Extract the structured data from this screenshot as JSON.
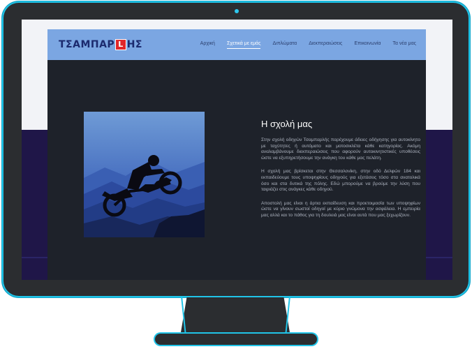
{
  "site": {
    "logo": {
      "text_before": "ΤΣΑΜΠΑΡ",
      "highlight": "L",
      "text_after": "ΗΣ"
    },
    "nav": [
      {
        "label": "Αρχική",
        "active": false
      },
      {
        "label": "Σχετικά με εμάς",
        "active": true
      },
      {
        "label": "Διπλώματα",
        "active": false
      },
      {
        "label": "Διεκπεραιώσεις",
        "active": false
      },
      {
        "label": "Επικοινωνία",
        "active": false
      },
      {
        "label": "Τα νέα μας",
        "active": false
      }
    ]
  },
  "about": {
    "heading": "Η σχολή μας",
    "paragraphs": [
      "Στην σχολή οδηγών Τσαμπαρλής παρέχουμε άδειες οδήγησης για αυτοκίνητο με ταχύτητες ή αυτόματο και μοτοσικλέτα κάθε κατηγορίας. Ακόμη αναλαμβάνουμε διεκπεραιώσεις που αφορούν αυτοκινητιστικές υποθέσεις ώστε να εξυπηρετήσουμε την ανάγκη του κάθε μας πελάτη.",
      "Η σχολή μας βρίσκεται στην Θεσσαλονίκη, στην οδό Δελφών 184 και εκπαιδεύουμε τους υποψηφίους οδηγούς για εξετάσεις τόσο στα ανατολικά όσο και στα δυτικά της πόλης. Εδώ μπορούμε να βρούμε την λύση που ταιριάζει στις ανάγκες κάθε οδηγού.",
      "Αποστολή μας είναι η άρτια εκπαίδευση και προετοιμασία των υποψηφίων ώστε να γίνουν σωστοί οδηγοί με κύριο γνώμονα την ασφάλεια. Η εμπειρία μας αλλά και το πάθος για τη δουλειά μας είναι αυτά που μας ξεχωρίζουν."
    ]
  },
  "colors": {
    "navbar": "#7ba6e2",
    "page_bg": "#1e222a",
    "monitor": "#2b2d30",
    "accent": "#20c4e8",
    "logo_red": "#e0262b"
  },
  "icons": {
    "photo": "motocross-rider-silhouette"
  }
}
